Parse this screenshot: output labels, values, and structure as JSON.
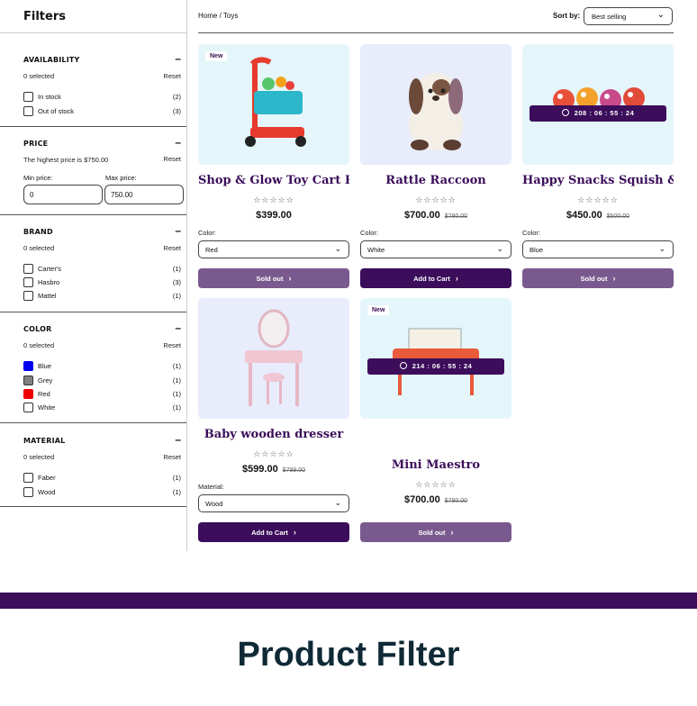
{
  "sidebar": {
    "title": "Filters",
    "availability": {
      "title": "AVAILABILITY",
      "selected": "0 selected",
      "reset": "Reset",
      "options": [
        {
          "label": "In stock",
          "count": "(2)"
        },
        {
          "label": "Out of stock",
          "count": "(3)"
        }
      ]
    },
    "price": {
      "title": "PRICE",
      "note": "The highest price is $750.00",
      "reset": "Reset",
      "min_label": "Min price:",
      "max_label": "Max price:",
      "min_value": "0",
      "max_value": "750.00"
    },
    "brand": {
      "title": "BRAND",
      "selected": "0 selected",
      "reset": "Reset",
      "options": [
        {
          "label": "Carter's",
          "count": "(1)"
        },
        {
          "label": "Hasbro",
          "count": "(3)"
        },
        {
          "label": "Mattel",
          "count": "(1)"
        }
      ]
    },
    "color": {
      "title": "COLOR",
      "selected": "0 selected",
      "reset": "Reset",
      "options": [
        {
          "label": "Blue",
          "count": "(1)",
          "swatch": "#0000ee"
        },
        {
          "label": "Grey",
          "count": "(1)",
          "swatch": "#808080"
        },
        {
          "label": "Red",
          "count": "(1)",
          "swatch": "#ee0000"
        },
        {
          "label": "White",
          "count": "(1)",
          "swatch": "#ffffff"
        }
      ]
    },
    "material": {
      "title": "MATERIAL",
      "selected": "0 selected",
      "reset": "Reset",
      "options": [
        {
          "label": "Faber",
          "count": "(1)"
        },
        {
          "label": "Wood",
          "count": "(1)"
        }
      ]
    },
    "minus": "–"
  },
  "topbar": {
    "breadcrumb": "Home /  Toys",
    "sort_label": "Sort by:",
    "sort_value": "Best selling"
  },
  "products": [
    {
      "name": "Shop & Glow Toy Cart Red",
      "stars": "☆☆☆☆☆",
      "price": "$399.00",
      "old_price": "",
      "badge": "New",
      "variant_label": "Color:",
      "variant_value": "Red",
      "button": "Sold out"
    },
    {
      "name": "Rattle Raccoon",
      "stars": "☆☆☆☆☆",
      "price": "$700.00",
      "old_price": "$780.00",
      "variant_label": "Color:",
      "variant_value": "White",
      "button": "Add to Cart"
    },
    {
      "name": "Happy Snacks Squish &...",
      "stars": "☆☆☆☆☆",
      "price": "$450.00",
      "old_price": "$500.00",
      "timer": "208  :  06  :  55  :  24",
      "variant_label": "Color:",
      "variant_value": "Blue",
      "button": "Sold out"
    },
    {
      "name": "Baby wooden dresser",
      "stars": "☆☆☆☆☆",
      "price": "$599.00",
      "old_price": "$799.00",
      "variant_label": "Material:",
      "variant_value": "Wood",
      "button": "Add to Cart"
    },
    {
      "name": "Mini Maestro",
      "stars": "☆☆☆☆☆",
      "price": "$700.00",
      "old_price": "$780.00",
      "badge": "New",
      "timer": "214  :  06  :  55  :  24",
      "button": "Sold out"
    }
  ],
  "icons": {
    "chevron": "⌄",
    "arrow": "›",
    "clock": "clock-icon"
  },
  "footer": {
    "title": "Product Filter"
  },
  "colors": {
    "brand_purple": "#3b0d5a",
    "muted_purple": "#7a5a8e",
    "card_bg": "#e5f6fb",
    "card_bg_alt": "#e8ecfb"
  }
}
